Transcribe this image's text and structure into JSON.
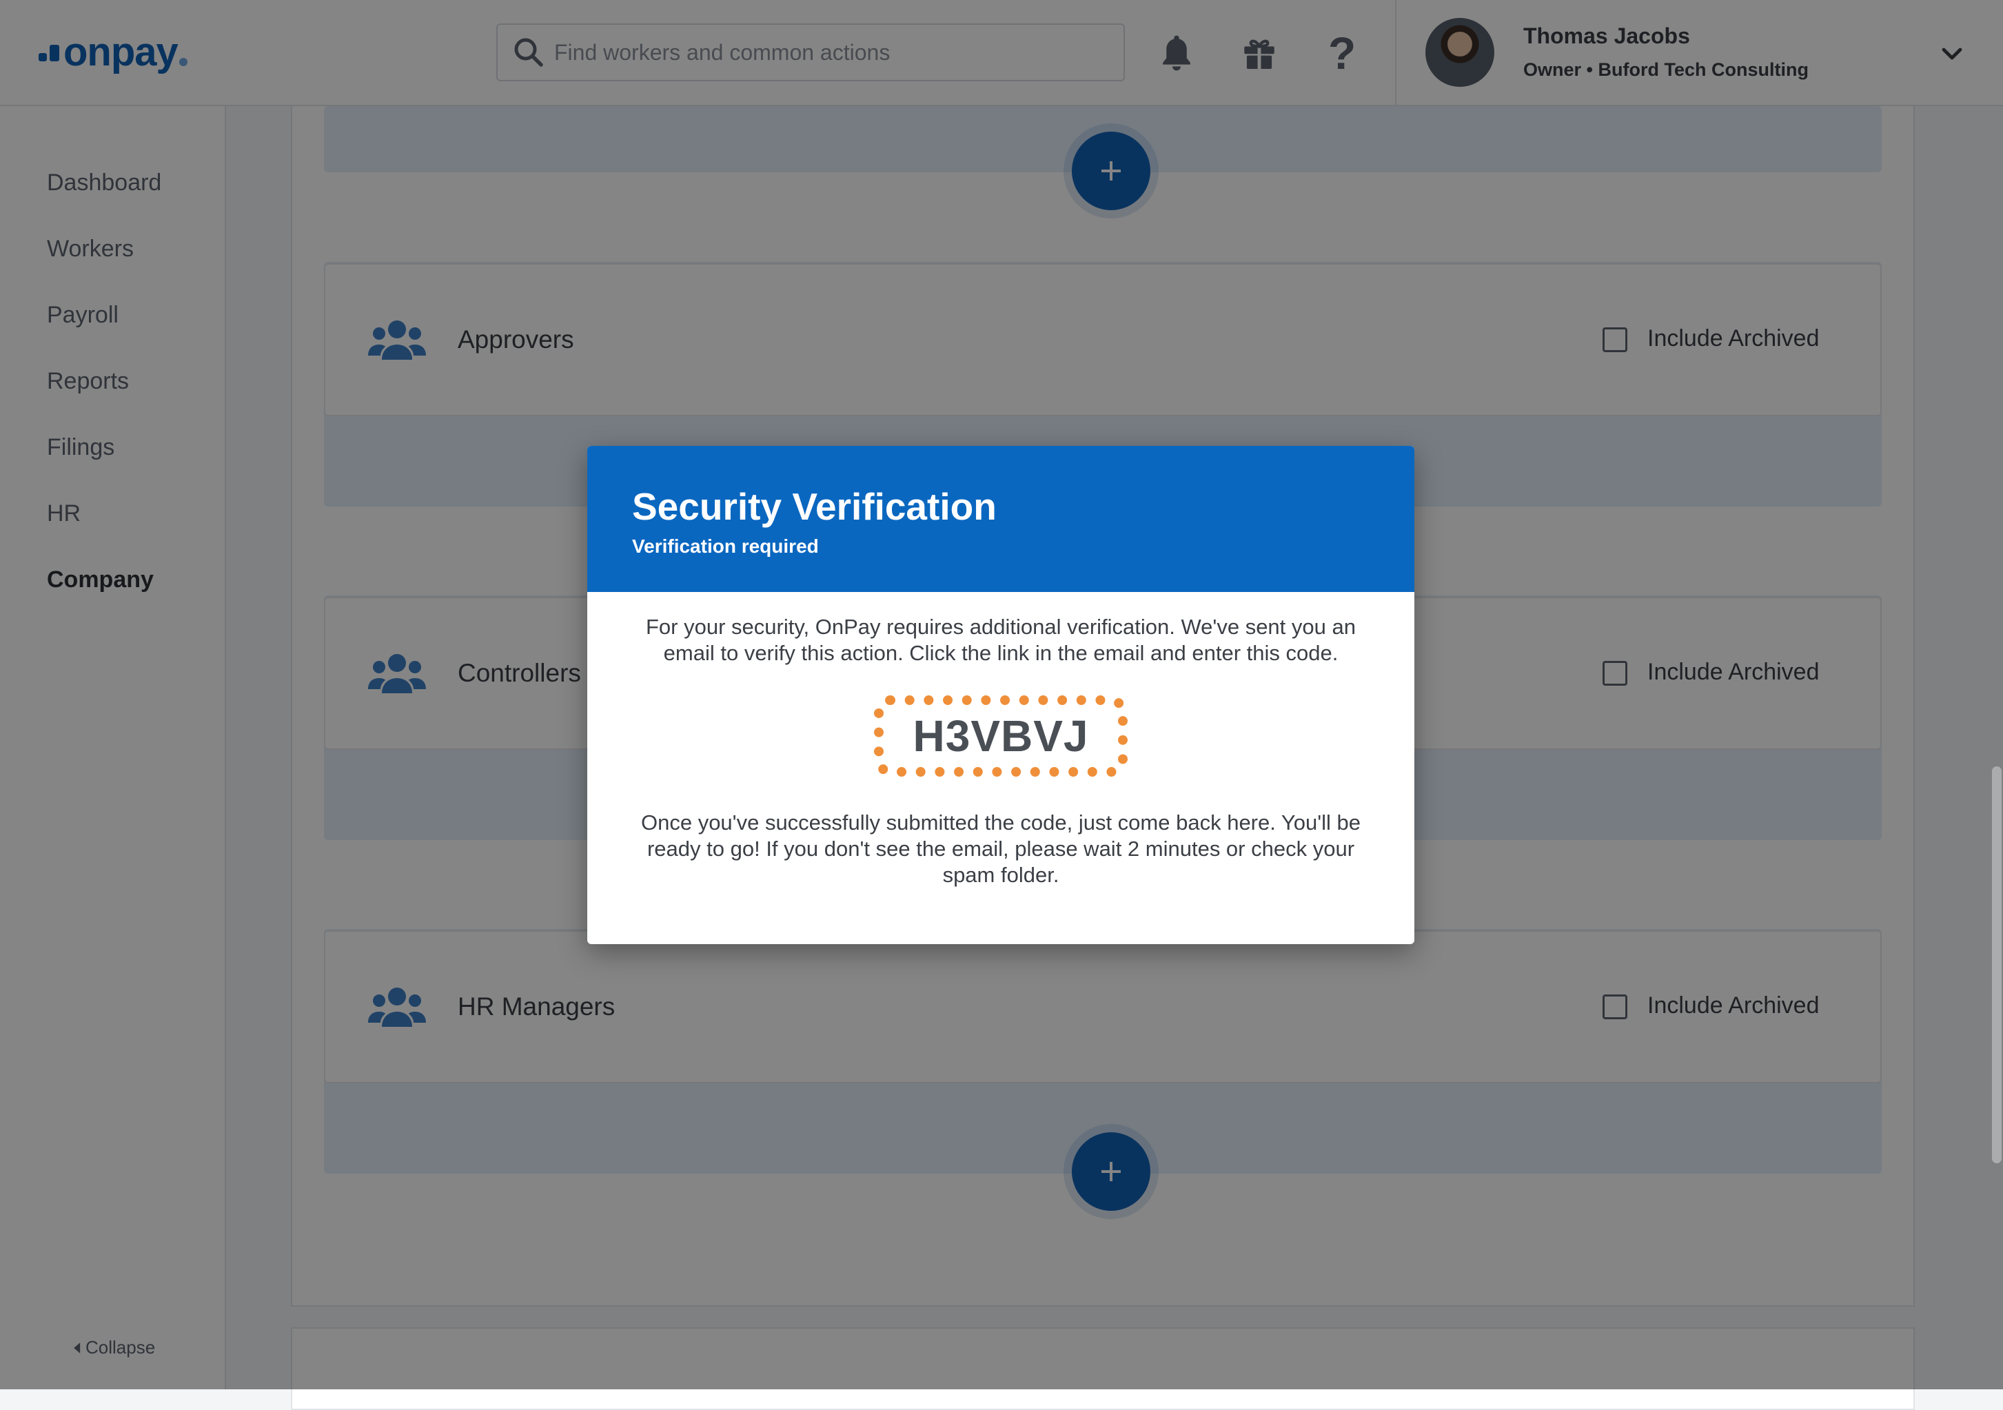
{
  "header": {
    "logo_text": "onpay",
    "search": {
      "placeholder": "Find workers and common actions",
      "value": ""
    },
    "icons": [
      "bell-icon",
      "gift-icon",
      "help-icon"
    ],
    "user": {
      "name": "Thomas Jacobs",
      "role": "Owner • Buford Tech Consulting"
    }
  },
  "sidebar": {
    "items": [
      {
        "label": "Dashboard",
        "active": false
      },
      {
        "label": "Workers",
        "active": false
      },
      {
        "label": "Payroll",
        "active": false
      },
      {
        "label": "Reports",
        "active": false
      },
      {
        "label": "Filings",
        "active": false
      },
      {
        "label": "HR",
        "active": false
      },
      {
        "label": "Company",
        "active": true
      }
    ],
    "collapse_label": "Collapse"
  },
  "content": {
    "groups": [
      {
        "title": "Approvers",
        "checkbox_label": "Include Archived",
        "checked": false
      },
      {
        "title": "Controllers",
        "checkbox_label": "Include Archived",
        "checked": false
      },
      {
        "title": "HR Managers",
        "checkbox_label": "Include Archived",
        "checked": false
      }
    ],
    "add_label": "+"
  },
  "modal": {
    "title": "Security Verification",
    "subtitle": "Verification required",
    "message": "For your security, OnPay requires additional verification. We've sent you an email to verify this action. Click the link in the email and enter this code.",
    "code": "H3VBVJ",
    "footer": "Once you've successfully submitted the code, just come back here. You'll be ready to go! If you don't see the email, please wait 2 minutes or check your spam folder."
  },
  "colors": {
    "brand": "#1262b6",
    "modal_header": "#0a67c0",
    "code_border": "#ef8f3a"
  }
}
